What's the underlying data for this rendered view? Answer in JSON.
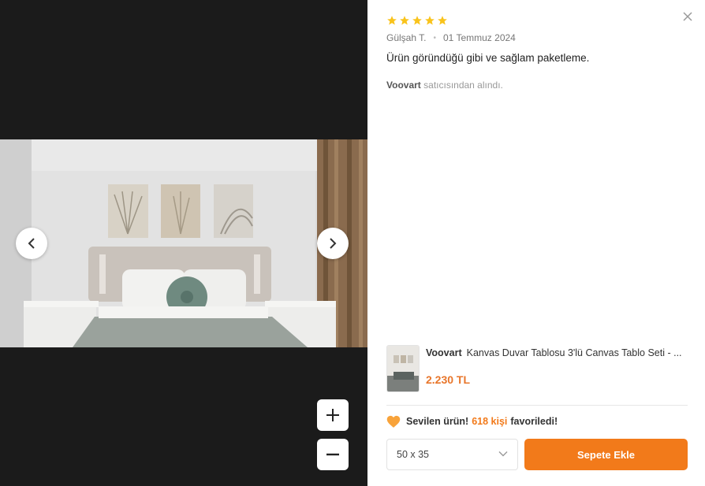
{
  "review": {
    "rating": 5,
    "author": "Gülşah T.",
    "date": "01 Temmuz 2024",
    "text": "Ürün göründüğü gibi ve sağlam paketleme.",
    "seller_name": "Voovart",
    "seller_suffix": "satıcısından alındı."
  },
  "product": {
    "brand": "Voovart",
    "title": "Kanvas Duvar Tablosu 3'lü Canvas Tablo Seti - ...",
    "price": "2.230 TL"
  },
  "favorite": {
    "label": "Sevilen ürün!",
    "count": "618 kişi",
    "suffix": "favoriledi!"
  },
  "size_select": {
    "value": "50 x 35"
  },
  "add_to_cart_label": "Sepete Ekle",
  "colors": {
    "accent": "#f27a1a",
    "star": "#f9c31b",
    "viewer_bg": "#1b1b1b"
  },
  "icons": {
    "close": "close-icon",
    "prev": "chevron-left-icon",
    "next": "chevron-right-icon",
    "zoom_in": "plus-icon",
    "zoom_out": "minus-icon",
    "heart": "heart-icon",
    "dropdown": "chevron-down-icon"
  }
}
